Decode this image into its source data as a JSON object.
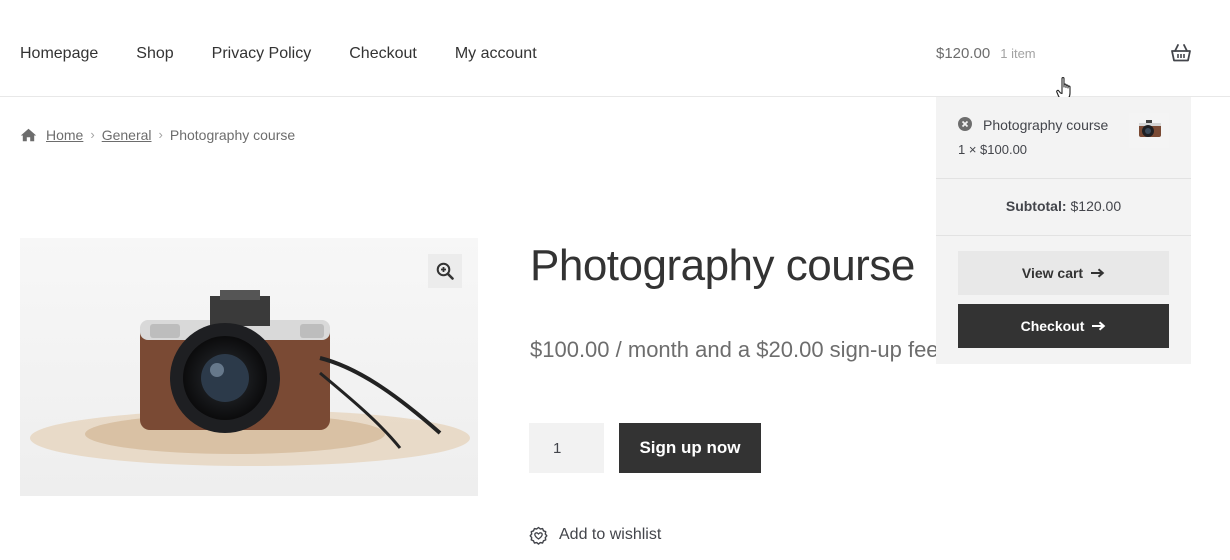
{
  "nav": {
    "items": [
      {
        "label": "Homepage"
      },
      {
        "label": "Shop"
      },
      {
        "label": "Privacy Policy"
      },
      {
        "label": "Checkout"
      },
      {
        "label": "My account"
      }
    ]
  },
  "cart": {
    "amount": "$120.00",
    "count": "1 item",
    "icon": "basket-icon"
  },
  "breadcrumb": {
    "icon": "home-icon",
    "home": "Home",
    "category": "General",
    "current": "Photography course"
  },
  "product": {
    "title": "Photography course",
    "price_text": "$100.00 / month and a $20.00 sign-up fee",
    "quantity": "1",
    "cta": "Sign up now",
    "wishlist": "Add to wishlist"
  },
  "mini_cart": {
    "item_name": "Photography course",
    "item_qty": "1 × $100.00",
    "subtotal_label": "Subtotal:",
    "subtotal_value": "$120.00",
    "view_cart": "View cart",
    "checkout": "Checkout"
  },
  "colors": {
    "dark_button": "#333333",
    "light_button": "#e8e8e8",
    "dropdown_bg": "#f3f3f3",
    "text": "#43454b",
    "muted": "#6d6d6d"
  }
}
